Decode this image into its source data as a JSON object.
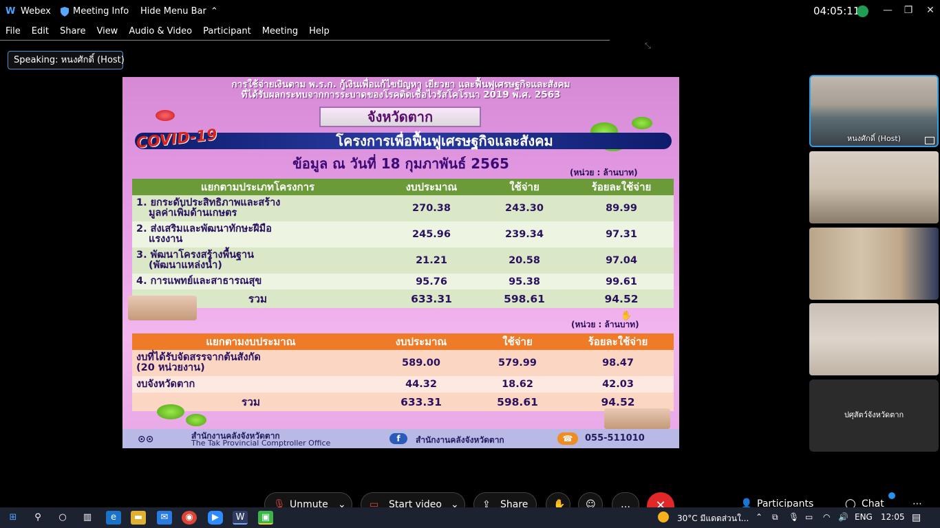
{
  "titlebar": {
    "app": "Webex",
    "meeting_info": "Meeting Info",
    "hide_menu": "Hide Menu Bar",
    "clock": "04:05:11"
  },
  "menu": [
    "File",
    "Edit",
    "Share",
    "View",
    "Audio & Video",
    "Participant",
    "Meeting",
    "Help"
  ],
  "speaking": "Speaking: หนงศักดิ์ (Host)",
  "slide": {
    "head_line1": "การใช้จ่ายเงินตาม พ.ร.ก. กู้เงินเพื่อแก้ไขปัญหา เยียวยา และฟื้นฟูเศรษฐกิจและสังคม",
    "head_line2": "ที่ได้รับผลกระทบจากการระบาดของโรคติดเชื้อไวรัสโคโรนา 2019 พ.ศ. 2563",
    "province": "จังหวัดตาก",
    "covid": "COVID-19",
    "banner": "โครงการเพื่อฟื้นฟูเศรษฐกิจและสังคม",
    "date": "ข้อมูล ณ วันที่ 18 กุมภาพันธ์ 2565",
    "unit": "(หน่วย : ล้านบาท)",
    "table1": {
      "headers": [
        "แยกตามประเภทโครงการ",
        "งบประมาณ",
        "ใช้จ่าย",
        "ร้อยละใช้จ่าย"
      ],
      "rows": [
        {
          "l1": "1. ยกระดับประสิทธิภาพและสร้าง",
          "l2": "มูลค่าเพิ่มด้านเกษตร",
          "budget": "270.38",
          "spent": "243.30",
          "pct": "89.99"
        },
        {
          "l1": "2. ส่งเสริมและพัฒนาทักษะฝีมือ",
          "l2": "แรงงาน",
          "budget": "245.96",
          "spent": "239.34",
          "pct": "97.31"
        },
        {
          "l1": "3. พัฒนาโครงสร้างพื้นฐาน",
          "l2": "(พัฒนาแหล่งน้ำ)",
          "budget": "21.21",
          "spent": "20.58",
          "pct": "97.04"
        },
        {
          "l1": "4. การแพทย์และสาธารณสุข",
          "l2": "",
          "budget": "95.76",
          "spent": "95.38",
          "pct": "99.61"
        }
      ],
      "total": {
        "label": "รวม",
        "budget": "633.31",
        "spent": "598.61",
        "pct": "94.52"
      }
    },
    "table2": {
      "headers": [
        "แยกตามงบประมาณ",
        "งบประมาณ",
        "ใช้จ่าย",
        "ร้อยละใช้จ่าย"
      ],
      "rows": [
        {
          "l1": "งบที่ได้รับจัดสรรจากต้นสังกัด",
          "l2": "(20 หน่วยงาน)",
          "budget": "589.00",
          "spent": "579.99",
          "pct": "98.47"
        },
        {
          "l1": "งบจังหวัดตาก",
          "l2": "",
          "budget": "44.32",
          "spent": "18.62",
          "pct": "42.03"
        }
      ],
      "total": {
        "label": "รวม",
        "budget": "633.31",
        "spent": "598.61",
        "pct": "94.52"
      }
    },
    "footer": {
      "office_th": "สำนักงานคลังจังหวัดตาก",
      "office_en": "The Tak Provincial Comptroller Office",
      "facebook": "สำนักงานคลังจังหวัดตาก",
      "phone": "055-511010"
    }
  },
  "participants": {
    "host_label": "หนงศักดิ์ (Host)",
    "p5_label": "ปศุสัตว์จังหวัดตาก"
  },
  "controls": {
    "unmute": "Unmute",
    "start_video": "Start video",
    "share": "Share",
    "participants": "Participants",
    "chat": "Chat"
  },
  "taskbar": {
    "weather": "30°C  มีแดดส่วนใ...",
    "lang": "ENG",
    "time": "12:05"
  },
  "colors": {
    "accent": "#2fa0e6",
    "end": "#e02828",
    "slide_bg": "#e79ee6",
    "table1_header": "#6b9b38",
    "table2_header": "#ef7a28"
  }
}
